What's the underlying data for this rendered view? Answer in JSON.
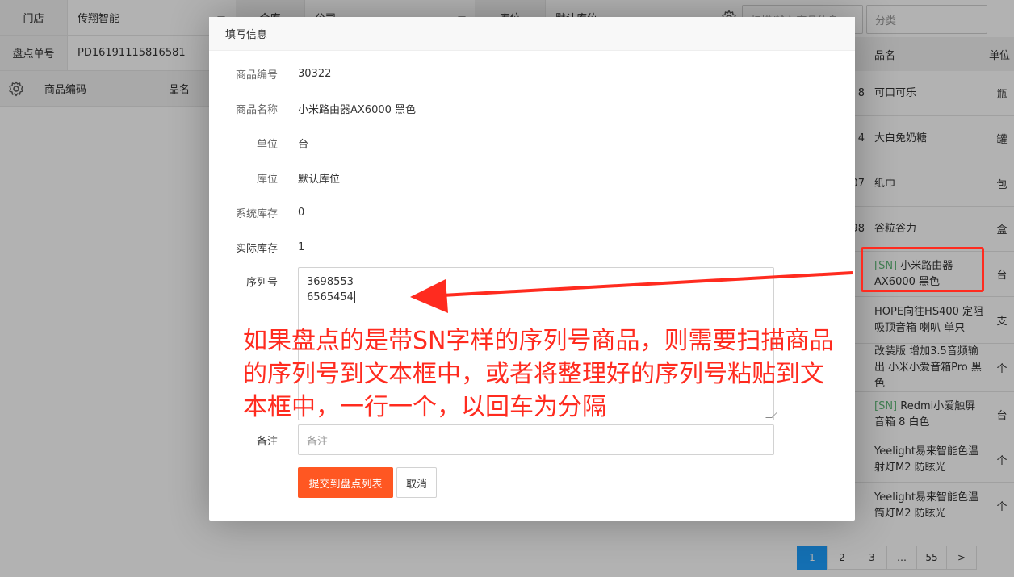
{
  "background": {
    "store_label": "门店",
    "store_value": "传翔智能",
    "warehouse_label": "仓库",
    "warehouse_value": "公司",
    "location_label": "库位",
    "location_value": "默认库位",
    "order_label": "盘点单号",
    "order_value": "PD16191115816581",
    "left_table_headers": [
      "商品编码",
      "品名"
    ]
  },
  "right_panel": {
    "search_placeholder": "扫描/输入商品信息",
    "category_placeholder": "分类",
    "headers": {
      "name": "品名",
      "unit": "单位"
    },
    "rows": [
      {
        "code": "8",
        "sn": "",
        "name": "可口可乐",
        "unit": "瓶"
      },
      {
        "code": "4",
        "sn": "",
        "name": "大白兔奶糖",
        "unit": "罐"
      },
      {
        "code": "07",
        "sn": "",
        "name": "纸巾",
        "unit": "包"
      },
      {
        "code": "98",
        "sn": "",
        "name": "谷粒谷力",
        "unit": "盒"
      },
      {
        "code": "",
        "sn": "[SN]",
        "name": "小米路由器AX6000 黑色",
        "unit": "台"
      },
      {
        "code": "",
        "sn": "",
        "name": "HOPE向往HS400 定阻吸顶音箱 喇叭 单只",
        "unit": "支"
      },
      {
        "code": "",
        "sn": "",
        "name": "改装版 增加3.5音频输出 小米小爱音箱Pro 黑色",
        "unit": "个"
      },
      {
        "code": "",
        "sn": "[SN]",
        "name": "Redmi小爱触屏音箱 8 白色",
        "unit": "台"
      },
      {
        "code": "",
        "sn": "",
        "name": "Yeelight易来智能色温射灯M2 防眩光",
        "unit": "个"
      },
      {
        "code": "",
        "sn": "",
        "name": "Yeelight易来智能色温筒灯M2 防眩光",
        "unit": "个"
      }
    ],
    "pagination": [
      "1",
      "2",
      "3",
      "…",
      "55",
      ">"
    ],
    "current_page": "1"
  },
  "modal": {
    "title": "填写信息",
    "fields": {
      "code_label": "商品编号",
      "code_value": "30322",
      "name_label": "商品名称",
      "name_value": "小米路由器AX6000 黑色",
      "unit_label": "单位",
      "unit_value": "台",
      "location_label": "库位",
      "location_value": "默认库位",
      "sys_stock_label": "系统库存",
      "sys_stock_value": "0",
      "actual_stock_label": "实际库存",
      "actual_stock_value": "1",
      "serial_label": "序列号",
      "serial_lines": [
        "3698553",
        "6565454"
      ],
      "note_label": "备注",
      "note_placeholder": "备注"
    },
    "submit_label": "提交到盘点列表",
    "cancel_label": "取消"
  },
  "annotation": {
    "text": "如果盘点的是带SN字样的序列号商品，则需要扫描商品的序列号到文本框中，或者将整理好的序列号粘贴到文本框中，一行一个，以回车为分隔",
    "color": "#FF2B1F"
  },
  "colors": {
    "primary_button": "#FF5722",
    "pager_active": "#1E9FFF",
    "sn_tag": "#5FB878"
  }
}
